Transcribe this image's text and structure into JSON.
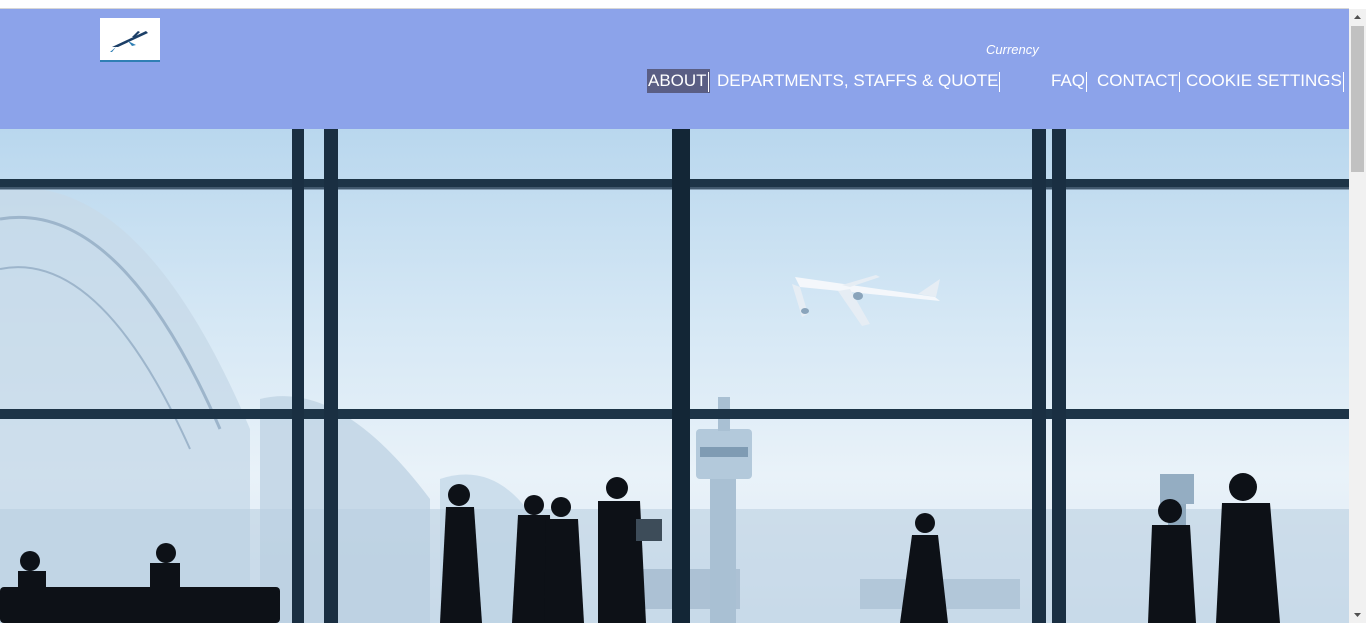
{
  "header": {
    "logo_icon": "airplane-logo",
    "currency_label": "Currency",
    "background_color": "#8ca3ea",
    "nav": [
      {
        "label": "ABOUT",
        "active": true
      },
      {
        "label": "DEPARTMENTS, STAFFS & QUOTE"
      },
      {
        "label": "FAQ"
      },
      {
        "label": "CONTACT"
      },
      {
        "label": "COOKIE SETTINGS"
      }
    ]
  },
  "hero": {
    "image": "airport-terminal-silhouettes-with-airplane"
  },
  "scrollbar": {
    "up_icon": "scroll-up-arrow",
    "down_icon": "scroll-down-arrow"
  }
}
